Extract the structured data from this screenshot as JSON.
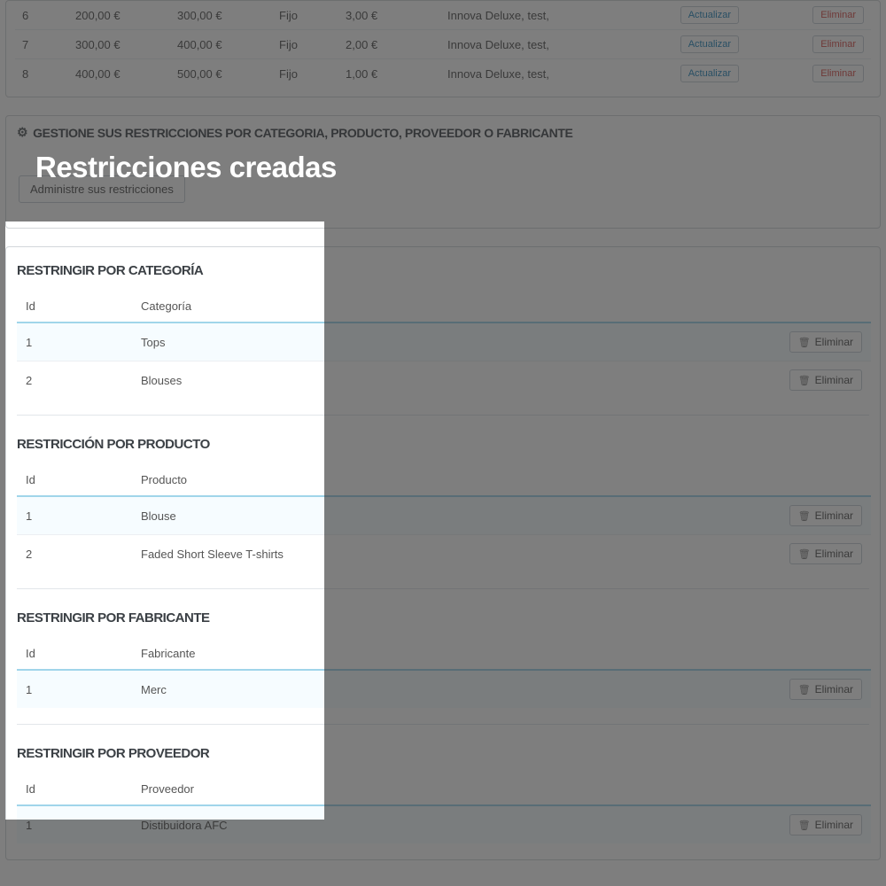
{
  "overlay": {
    "title": "Restricciones creadas"
  },
  "topTable": {
    "rows": [
      {
        "n": "6",
        "from": "200,00 €",
        "to": "300,00 €",
        "type": "Fijo",
        "val": "3,00 €",
        "mfr": "Innova Deluxe, test,"
      },
      {
        "n": "7",
        "from": "300,00 €",
        "to": "400,00 €",
        "type": "Fijo",
        "val": "2,00 €",
        "mfr": "Innova Deluxe, test,"
      },
      {
        "n": "8",
        "from": "400,00 €",
        "to": "500,00 €",
        "type": "Fijo",
        "val": "1,00 €",
        "mfr": "Innova Deluxe, test,"
      }
    ],
    "updateLabel": "Actualizar",
    "deleteLabel": "Eliminar"
  },
  "managePanel": {
    "heading": "GESTIONE SUS RESTRICCIONES POR CATEGORIA, PRODUCTO, PROVEEDOR O FABRICANTE",
    "buttonLabel": "Administre sus restricciones"
  },
  "deleteLabel": "Eliminar",
  "sections": {
    "category": {
      "title": "RESTRINGIR POR CATEGORÍA",
      "idHeader": "Id",
      "nameHeader": "Categoría",
      "rows": [
        {
          "id": "1",
          "name": "Tops"
        },
        {
          "id": "2",
          "name": "Blouses"
        }
      ]
    },
    "product": {
      "title": "RESTRICCIÓN POR PRODUCTO",
      "idHeader": "Id",
      "nameHeader": "Producto",
      "rows": [
        {
          "id": "1",
          "name": "Blouse"
        },
        {
          "id": "2",
          "name": "Faded Short Sleeve T-shirts"
        }
      ]
    },
    "manufacturer": {
      "title": "RESTRINGIR POR FABRICANTE",
      "idHeader": "Id",
      "nameHeader": "Fabricante",
      "rows": [
        {
          "id": "1",
          "name": "Merc"
        }
      ]
    },
    "supplier": {
      "title": "RESTRINGIR POR PROVEEDOR",
      "idHeader": "Id",
      "nameHeader": "Proveedor",
      "rows": [
        {
          "id": "1",
          "name": "Distibuidora AFC"
        }
      ]
    }
  }
}
